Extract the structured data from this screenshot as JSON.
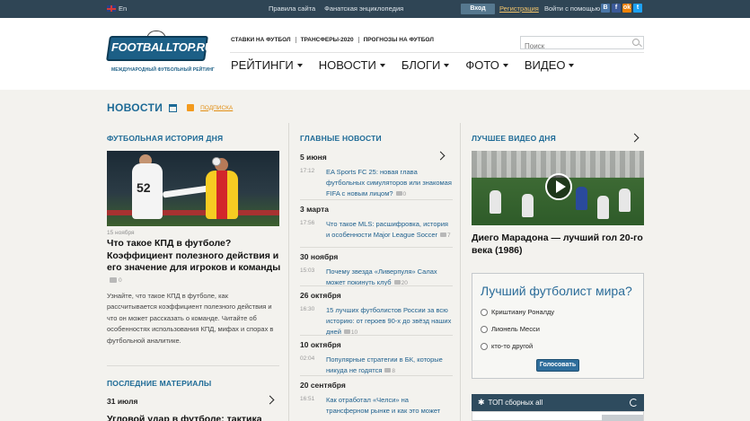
{
  "topbar": {
    "lang": "En",
    "links": [
      "Правила сайта",
      "Фанатская энциклопедия"
    ],
    "login": "Вход",
    "register": "Регистрация",
    "login_via": "Войти с помощью",
    "socials": [
      {
        "name": "vk-icon",
        "glyph": "В",
        "color": "#4a76a8"
      },
      {
        "name": "facebook-icon",
        "glyph": "f",
        "color": "#3b5998"
      },
      {
        "name": "odnoklassniki-icon",
        "glyph": "ok",
        "color": "#ee8208"
      },
      {
        "name": "twitter-icon",
        "glyph": "t",
        "color": "#1da1f2"
      }
    ]
  },
  "header": {
    "logo_text": "FOOTBALLTOP.RU",
    "logo_tagline": "МЕЖДУНАРОДНЫЙ ФУТБОЛЬНЫЙ РЕЙТИНГ",
    "sublinks": [
      "СТАВКИ НА ФУТБОЛ",
      "ТРАНСФЕРЫ-2020",
      "ПРОГНОЗЫ НА ФУТБОЛ"
    ],
    "search_placeholder": "Поиск",
    "nav": [
      "РЕЙТИНГИ",
      "НОВОСТИ",
      "БЛОГИ",
      "ФОТО",
      "ВИДЕО"
    ]
  },
  "page": {
    "title": "НОВОСТИ",
    "subscribe": "ПОДПИСКА"
  },
  "left": {
    "heading": "ФУТБОЛЬНАЯ ИСТОРИЯ ДНЯ",
    "date": "15 ноября",
    "title": "Что такое КПД в футболе? Коэффициент полезного действия и его значение для игроков и команды",
    "comments": "0",
    "text": "Узнайте, что такое КПД в футболе, как рассчитывается коэффициент полезного действия и что он может рассказать о команде. Читайте об особенностях использования КПД, мифах и спорах в футбольной аналитике.",
    "recent_heading": "ПОСЛЕДНИЕ МАТЕРИАЛЫ",
    "recent_date": "31 июля",
    "recent_title": "Угловой удар в футболе: тактика"
  },
  "middle": {
    "heading": "ГЛАВНЫЕ НОВОСТИ",
    "groups": [
      {
        "date": "5 июня",
        "time": "17:12",
        "text": "EA Sports FC 25: новая глава футбольных симуляторов или знакомая FIFA с новым лицом?",
        "comments": "0"
      },
      {
        "date": "3 марта",
        "time": "17:56",
        "text": "Что такое MLS: расшифровка, история и особенности Major League Soccer",
        "comments": "7"
      },
      {
        "date": "30 ноября",
        "time": "15:03",
        "text": "Почему звезда «Ливерпуля» Салах может покинуть клуб",
        "comments": "20"
      },
      {
        "date": "26 октября",
        "time": "16:30",
        "text": "15 лучших футболистов России за всю историю: от героев 90-х до звёзд наших дней",
        "comments": "10"
      },
      {
        "date": "10 октября",
        "time": "02:04",
        "text": "Популярные стратегии в БК, которые никуда не годятся",
        "comments": "8"
      },
      {
        "date": "20 сентября",
        "time": "16:51",
        "text": "Как отработал «Челси» на трансферном рынке и как это может",
        "comments": ""
      }
    ]
  },
  "right": {
    "heading": "ЛУЧШЕЕ ВИДЕО ДНЯ",
    "video_title": "Диего Марадона — лучший гол 20-го века (1986)",
    "poll_question": "Лучший футболист мира?",
    "poll_options": [
      "Криштиану Роналду",
      "Лионель Месси",
      "кто-то другой"
    ],
    "vote": "Голосовать",
    "top_title": "ТОП сборных all"
  },
  "colors": {
    "accent": "#1d6a96",
    "topbar": "#2f4555",
    "background": "#f3f2ee"
  }
}
